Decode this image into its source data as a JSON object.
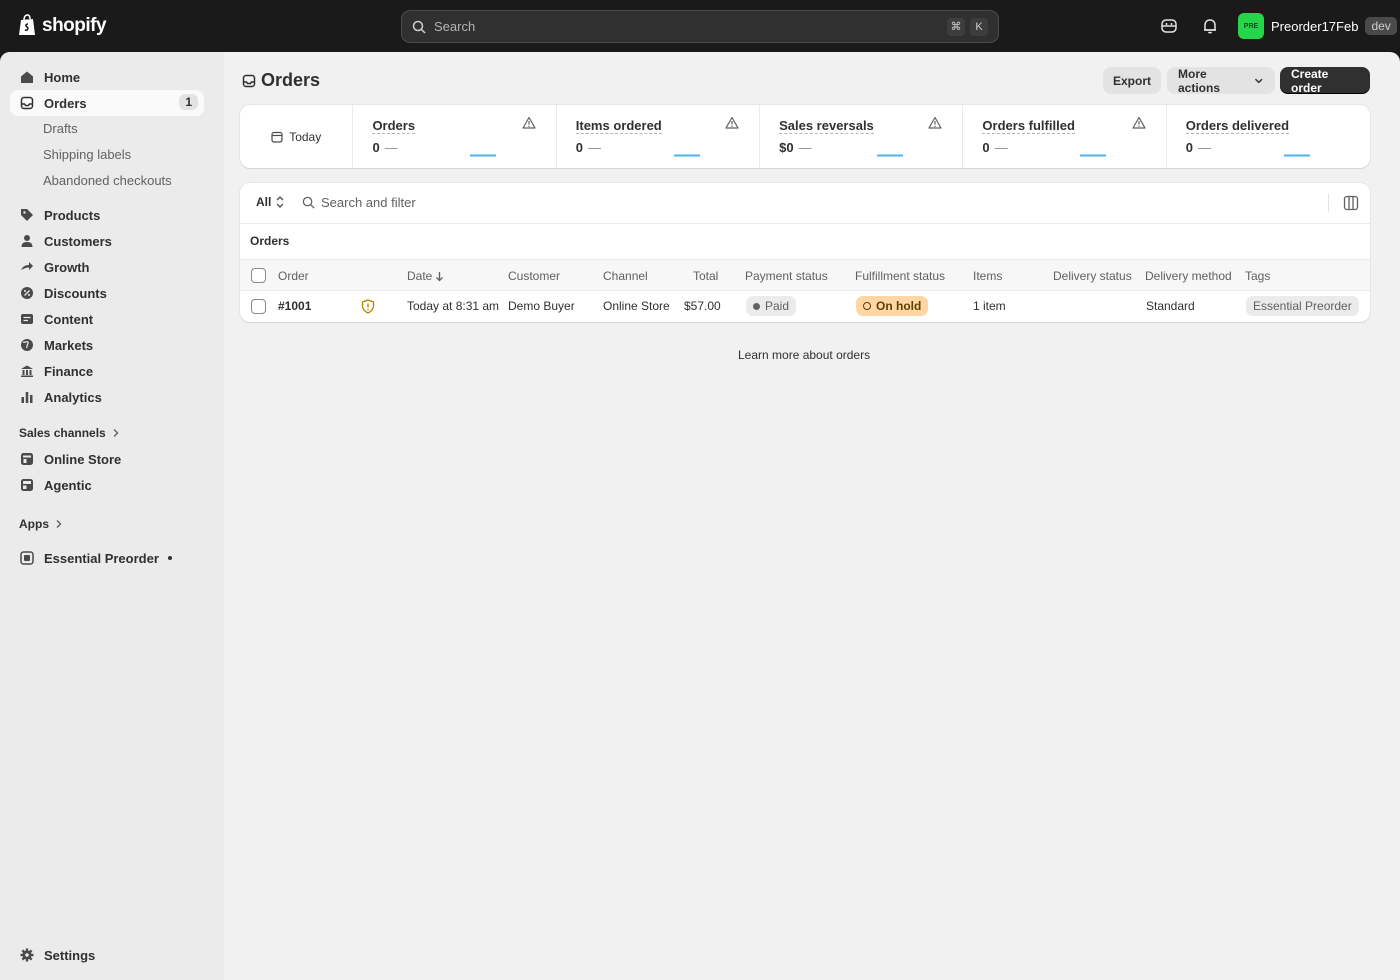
{
  "topbar": {
    "logo_text": "shopify",
    "search_placeholder": "Search",
    "shortcut_cmd": "⌘",
    "shortcut_key": "K",
    "store_avatar": "PRE",
    "store_name": "Preorder17Feb",
    "store_badge": "dev"
  },
  "sidebar": {
    "home": "Home",
    "orders": "Orders",
    "orders_count": "1",
    "drafts": "Drafts",
    "shipping_labels": "Shipping labels",
    "abandoned_checkouts": "Abandoned checkouts",
    "products": "Products",
    "customers": "Customers",
    "growth": "Growth",
    "discounts": "Discounts",
    "content": "Content",
    "markets": "Markets",
    "finance": "Finance",
    "analytics": "Analytics",
    "sales_channels": "Sales channels",
    "online_store": "Online Store",
    "agentic": "Agentic",
    "apps": "Apps",
    "essential_preorder": "Essential Preorder",
    "settings": "Settings"
  },
  "page": {
    "title": "Orders",
    "export": "Export",
    "more_actions": "More actions",
    "create_order": "Create order"
  },
  "metrics": {
    "date_range": "Today",
    "items": [
      {
        "label": "Orders",
        "value": "0",
        "dash": "—"
      },
      {
        "label": "Items ordered",
        "value": "0",
        "dash": "—"
      },
      {
        "label": "Sales reversals",
        "value": "$0",
        "dash": "—"
      },
      {
        "label": "Orders fulfilled",
        "value": "0",
        "dash": "—"
      },
      {
        "label": "Orders delivered",
        "value": "0",
        "dash": "—"
      }
    ]
  },
  "table": {
    "tab_all": "All",
    "filter_placeholder": "Search and filter",
    "section_title": "Orders",
    "headers": {
      "order": "Order",
      "date": "Date",
      "customer": "Customer",
      "channel": "Channel",
      "total": "Total",
      "payment_status": "Payment status",
      "fulfillment_status": "Fulfillment status",
      "items": "Items",
      "delivery_status": "Delivery status",
      "delivery_method": "Delivery method",
      "tags": "Tags"
    },
    "rows": [
      {
        "order": "#1001",
        "date": "Today at 8:31 am",
        "customer": "Demo Buyer",
        "channel": "Online Store",
        "total": "$57.00",
        "payment_status": "Paid",
        "fulfillment_status": "On hold",
        "items": "1 item",
        "delivery_status": "",
        "delivery_method": "Standard",
        "tag": "Essential Preorder"
      }
    ]
  },
  "footer": {
    "learn_more": "Learn more about orders"
  },
  "colors": {
    "topbar_bg": "#1a1a1a",
    "primary_button": "#303030",
    "on_hold_badge": "#ffd6a4",
    "sparkline": "#4bb4f0",
    "store_avatar": "#27d54a"
  }
}
